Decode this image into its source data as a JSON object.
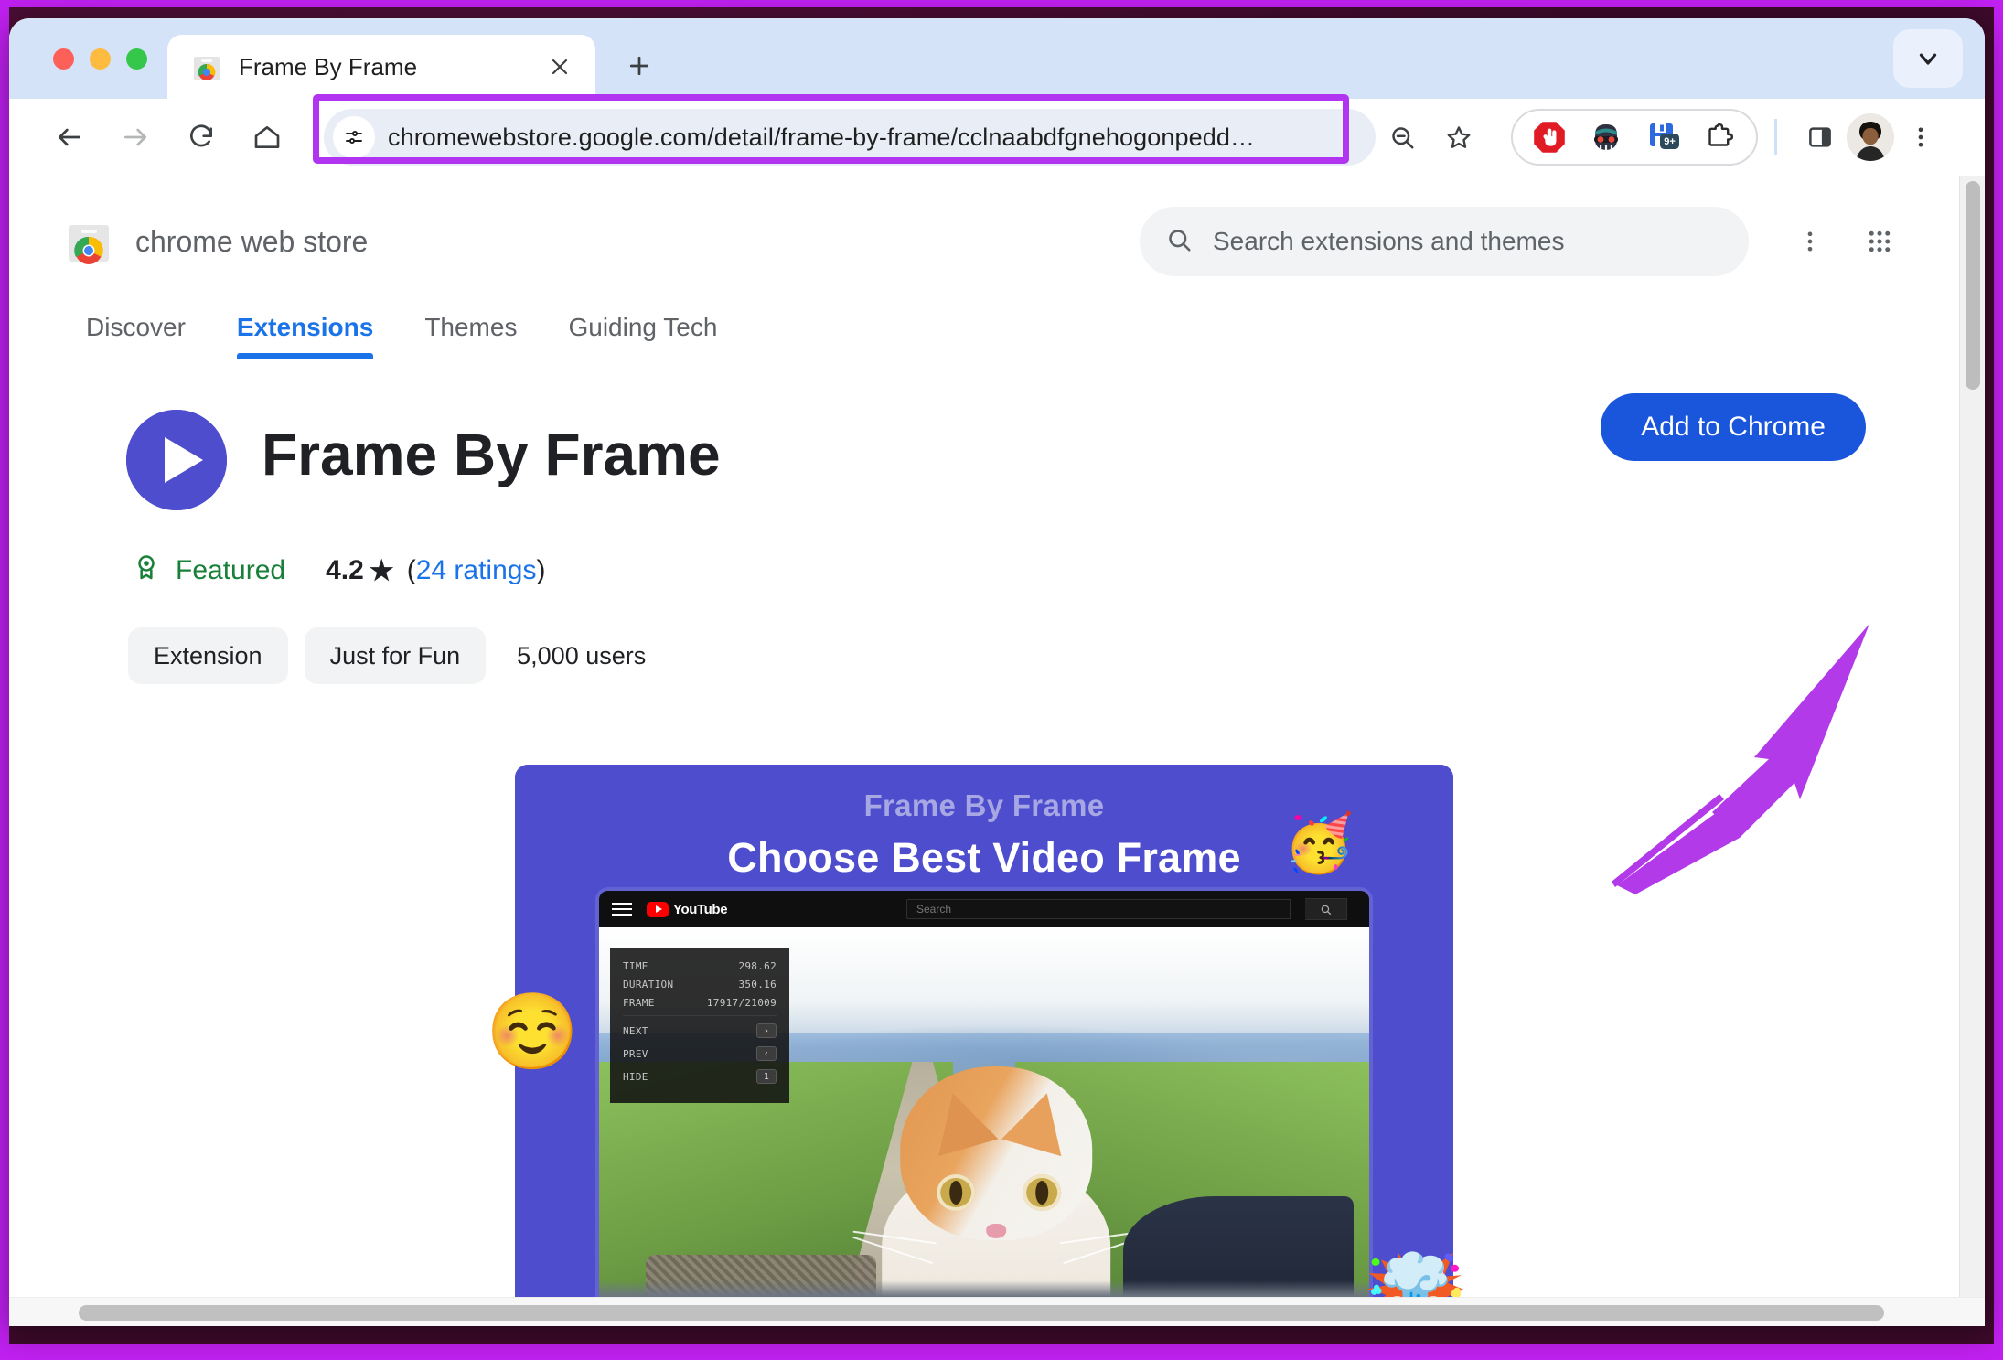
{
  "window": {
    "traffic_lights": [
      "close",
      "minimize",
      "maximize"
    ],
    "tab": {
      "title": "Frame By Frame",
      "favicon": "chrome-web-store-favicon",
      "close_label": "✕"
    },
    "new_tab_label": "+",
    "tab_list_chevron": "chevron-down-icon"
  },
  "toolbar": {
    "back_label": "←",
    "forward_label": "→",
    "reload_label": "⟳",
    "home_label": "⌂",
    "url": "chromewebstore.google.com/detail/frame-by-frame/cclnaabdfgnehogonpedd…",
    "site_settings_icon": "tune-icon",
    "zoom_out_icon": "zoom-out-icon",
    "bookmark_icon": "star-icon",
    "extensions": [
      {
        "name": "adblock-icon",
        "glyph": "✋",
        "badge": ""
      },
      {
        "name": "privacy-mask-icon",
        "glyph": "🥷",
        "badge": ""
      },
      {
        "name": "save-icon",
        "glyph": "💾",
        "badge": "9+"
      },
      {
        "name": "extensions-puzzle-icon",
        "glyph": "🧩",
        "badge": ""
      }
    ],
    "side_panel_icon": "side-panel-icon",
    "profile_icon": "user-avatar",
    "menu_icon": "three-dot-menu-icon",
    "highlight_color": "#b135f0"
  },
  "store_header": {
    "logo_name": "chrome-web-store-logo",
    "brand": "chrome web store",
    "search_placeholder": "Search extensions and themes",
    "search_icon": "search-icon",
    "more_icon": "three-dot-menu-icon",
    "apps_icon": "google-apps-grid-icon"
  },
  "nav_tabs": [
    {
      "label": "Discover",
      "active": false
    },
    {
      "label": "Extensions",
      "active": true
    },
    {
      "label": "Themes",
      "active": false
    },
    {
      "label": "Guiding Tech",
      "active": false
    }
  ],
  "item": {
    "icon_name": "play-circle-icon",
    "icon_color": "#4d4dcd",
    "title": "Frame By Frame",
    "add_button_label": "Add to Chrome",
    "add_button_color": "#1a56db",
    "featured_label": "Featured",
    "featured_color": "#188038",
    "featured_icon": "award-ribbon-icon",
    "rating_value": "4.2",
    "rating_star": "★",
    "ratings_open_paren": "(",
    "ratings_link": "24 ratings",
    "ratings_close_paren": ")",
    "chips": [
      "Extension",
      "Just for Fun"
    ],
    "users": "5,000 users"
  },
  "promo": {
    "background_color": "#4d4dcd",
    "subtitle": "Frame By Frame",
    "title": "Choose Best Video Frame",
    "emoji_party": "🥳",
    "emoji_smile": "☺️",
    "emoji_explode": "🤯",
    "youtube": {
      "menu_icon": "hamburger-icon",
      "logo_text": "YouTube",
      "search_placeholder": "Search",
      "search_button_icon": "search-icon"
    },
    "overlay": {
      "rows": [
        {
          "label": "TIME",
          "value": "298.62"
        },
        {
          "label": "DURATION",
          "value": "350.16"
        },
        {
          "label": "FRAME",
          "value": "17917/21009"
        }
      ],
      "controls": [
        {
          "label": "NEXT",
          "key": "›"
        },
        {
          "label": "PREV",
          "key": "‹"
        },
        {
          "label": "HIDE",
          "key": "1"
        }
      ]
    }
  },
  "annotation": {
    "arrow_color": "#b23ae8",
    "target": "add-to-chrome-button"
  }
}
